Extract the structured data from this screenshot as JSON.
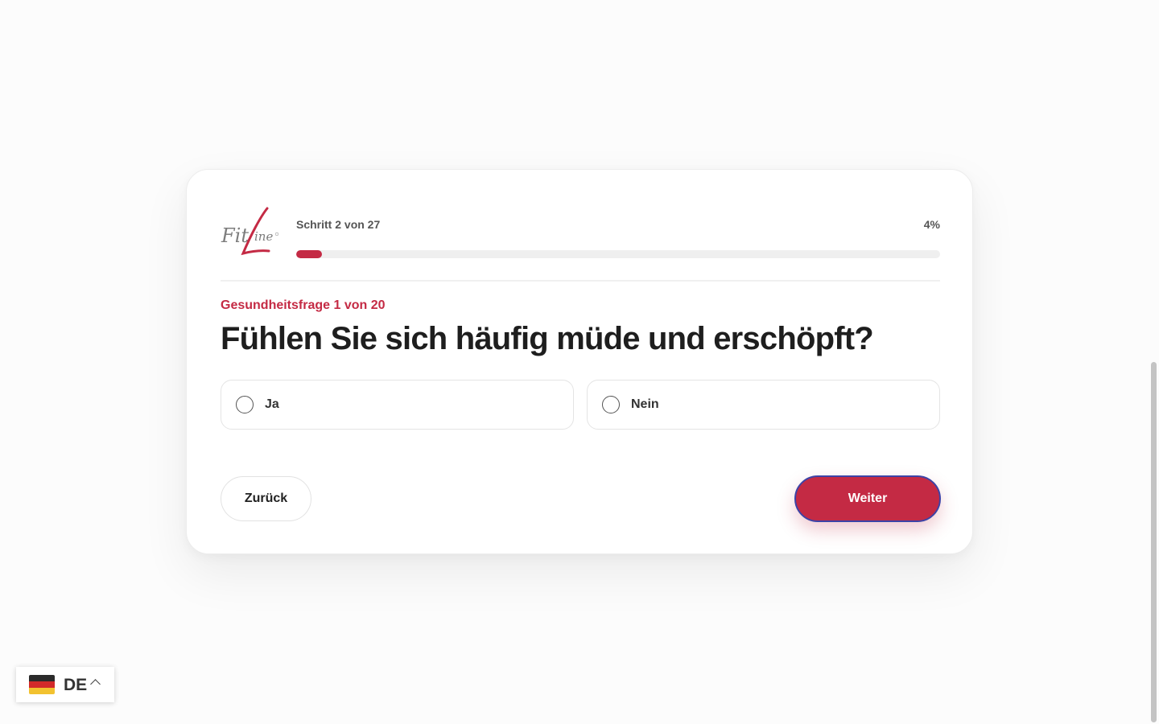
{
  "brand": {
    "logo_text": "FitLine",
    "accent_color": "#c42a44"
  },
  "progress": {
    "step_label": "Schritt 2 von 27",
    "percent_label": "4%",
    "percent_value": 4
  },
  "question": {
    "counter": "Gesundheitsfrage 1 von 20",
    "title": "Fühlen Sie sich häufig müde und erschöpft?",
    "options": [
      {
        "label": "Ja"
      },
      {
        "label": "Nein"
      }
    ]
  },
  "navigation": {
    "back_label": "Zurück",
    "next_label": "Weiter"
  },
  "language": {
    "code": "DE",
    "flag_icon": "germany-flag-icon"
  }
}
